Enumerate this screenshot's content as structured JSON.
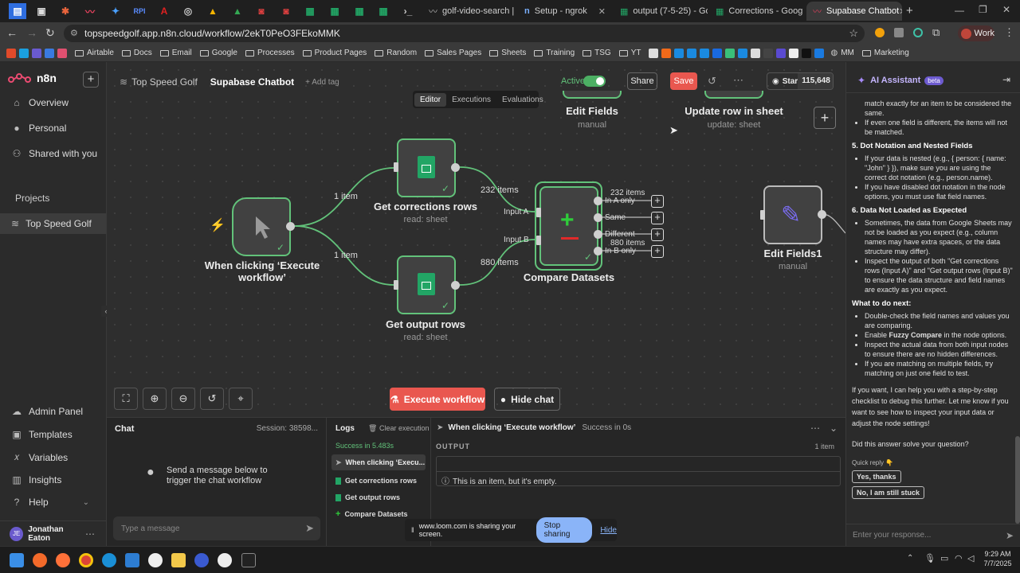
{
  "browser": {
    "tabs": [
      {
        "label": "golf-video-search | T"
      },
      {
        "label": "Setup - ngrok"
      },
      {
        "label": "output (7-5-25) - Go"
      },
      {
        "label": "Corrections - Google"
      },
      {
        "label": "Supabase Chatbot"
      }
    ],
    "url": "topspeedgolf.app.n8n.cloud/workflow/2ekT0PeO3FEkoMMK",
    "profile": "Work",
    "bookmarks": [
      "Airtable",
      "Docs",
      "Email",
      "Google",
      "Processes",
      "Product Pages",
      "Random",
      "Sales Pages",
      "Sheets",
      "Training",
      "TSG",
      "YT"
    ],
    "bookmark_end": [
      "MM",
      "Marketing"
    ]
  },
  "app": {
    "logo": "n8n",
    "nav": [
      "Overview",
      "Personal",
      "Shared with you"
    ],
    "projects_label": "Projects",
    "project_item": "Top Speed Golf",
    "bottom_nav": [
      "Admin Panel",
      "Templates",
      "Variables",
      "Insights",
      "Help"
    ],
    "user": {
      "initials": "JE",
      "name": "Jonathan Eaton"
    }
  },
  "header": {
    "project": "Top Speed Golf",
    "workflow": "Supabase Chatbot",
    "add_tag": "+ Add tag",
    "active_label": "Active",
    "share": "Share",
    "save": "Save",
    "star": "Star",
    "star_count": "115,648",
    "tabs": [
      "Editor",
      "Executions",
      "Evaluations"
    ]
  },
  "canvas": {
    "nodes": {
      "trigger": {
        "title": "When clicking ‘Execute workflow’"
      },
      "corrections": {
        "title": "Get corrections rows",
        "sub": "read: sheet"
      },
      "output": {
        "title": "Get output rows",
        "sub": "read: sheet"
      },
      "compare": {
        "title": "Compare Datasets",
        "input_a": "Input A",
        "input_b": "Input B"
      },
      "edit_top": {
        "title": "Edit Fields",
        "sub": "manual"
      },
      "update": {
        "title": "Update row in sheet",
        "sub": "update: sheet"
      },
      "edit1": {
        "title": "Edit Fields1",
        "sub": "manual"
      }
    },
    "edges": {
      "e1": "1 item",
      "e2": "1 item",
      "e3": "232 items",
      "e4": "880 items",
      "out_a": "232 items",
      "out_b": "880 items"
    },
    "outputs": [
      "In A only",
      "Same",
      "Different",
      "In B only"
    ],
    "execute_button": "Execute workflow",
    "hide_chat": "Hide chat"
  },
  "chat": {
    "title": "Chat",
    "session": "Session: 38598...",
    "empty_text": "Send a message below to trigger the chat workflow",
    "input_placeholder": "Type a message"
  },
  "logs": {
    "title": "Logs",
    "clear": "Clear execution",
    "status": "Success in 5.483s",
    "items": [
      "When clicking ‘Execu...",
      "Get corrections rows",
      "Get output rows",
      "Compare Datasets"
    ]
  },
  "output": {
    "node": "When clicking ‘Execute workflow’",
    "status": "Success in 0s",
    "heading": "OUTPUT",
    "count": "1 item",
    "message": "This is an item, but it's empty."
  },
  "loom": {
    "text": "www.loom.com is sharing your screen.",
    "stop": "Stop sharing",
    "hide": "Hide"
  },
  "assistant": {
    "title": "AI Assistant",
    "badge": "beta",
    "p0a": "match exactly for an item to be considered the same.",
    "p0b": "If even one field is different, the items will not be matched.",
    "h5": "5. Dot Notation and Nested Fields",
    "p5a": "If your data is nested (e.g., { person: { name: \"John\" } }), make sure you are using the correct dot notation (e.g., person.name).",
    "p5b": "If you have disabled dot notation in the node options, you must use flat field names.",
    "h6": "6. Data Not Loaded as Expected",
    "p6a": "Sometimes, the data from Google Sheets may not be loaded as you expect (e.g., column names may have extra spaces, or the data structure may differ).",
    "p6b": "Inspect the output of both \"Get corrections rows (Input A)\" and \"Get output rows (Input B)\" to ensure the data structure and field names are exactly as you expect.",
    "next": "What to do next:",
    "n1": "Double-check the field names and values you are comparing.",
    "n2a": "Enable ",
    "n2b": "Fuzzy Compare",
    "n2c": " in the node options.",
    "n3": "Inspect the actual data from both input nodes to ensure there are no hidden differences.",
    "n4": "If you are matching on multiple fields, try matching on just one field to test.",
    "closing": "If you want, I can help you with a step-by-step checklist to debug this further. Let me know if you want to see how to inspect your input data or adjust the node settings!",
    "question": "Did this answer solve your question?",
    "quick_reply": "Quick reply 👇",
    "yes": "Yes, thanks",
    "no": "No, I am still stuck",
    "placeholder": "Enter your response..."
  },
  "taskbar": {
    "time": "9:29 AM",
    "date": "7/7/2025"
  }
}
